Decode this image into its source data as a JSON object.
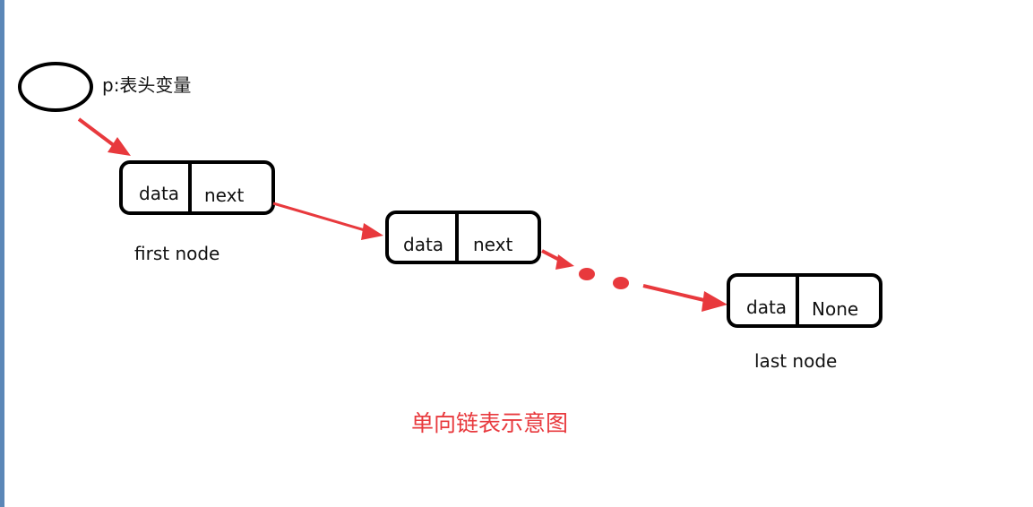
{
  "head_pointer": {
    "label": "p:表头变量"
  },
  "nodes": {
    "first": {
      "data_label": "data",
      "next_label": "next",
      "caption": "first node"
    },
    "second": {
      "data_label": "data",
      "next_label": "next"
    },
    "last": {
      "data_label": "data",
      "next_label": "None",
      "caption": "last node"
    }
  },
  "title": "单向链表示意图",
  "colors": {
    "arrow": "#e8393d",
    "title": "#e8393d",
    "stroke": "#000000",
    "left_border": "#5b87b7"
  }
}
